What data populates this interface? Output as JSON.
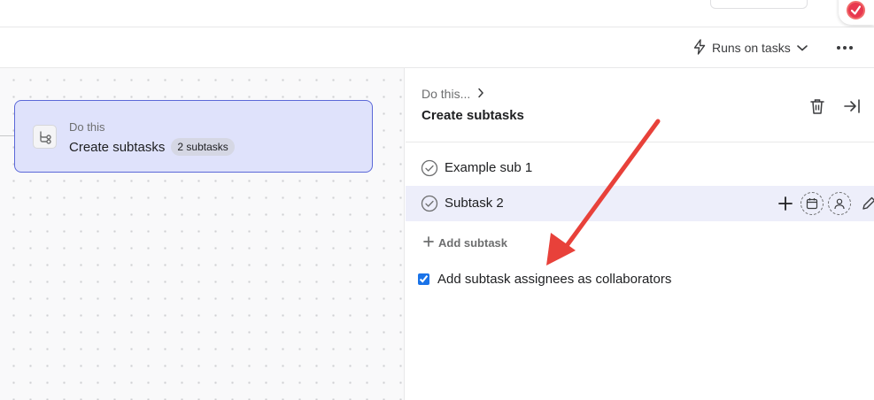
{
  "toolbar": {
    "runs_on_label": "Runs on tasks"
  },
  "canvas": {
    "node": {
      "title": "Do this",
      "subtitle": "Create subtasks",
      "count_pill": "2 subtasks"
    }
  },
  "panel": {
    "breadcrumb": "Do this...",
    "title": "Create subtasks",
    "subtasks": [
      {
        "label": "Example sub 1"
      },
      {
        "label": "Subtask 2"
      }
    ],
    "add_subtask_label": "Add subtask",
    "collaborators_label": "Add subtask assignees as collaborators",
    "collaborators_checked": true
  },
  "colors": {
    "node_fill": "#dfe2fb",
    "node_border": "#5b68d8",
    "highlight_row": "#edeefa",
    "annotation_arrow": "#e8413a",
    "app_badge": "#e8384f"
  }
}
